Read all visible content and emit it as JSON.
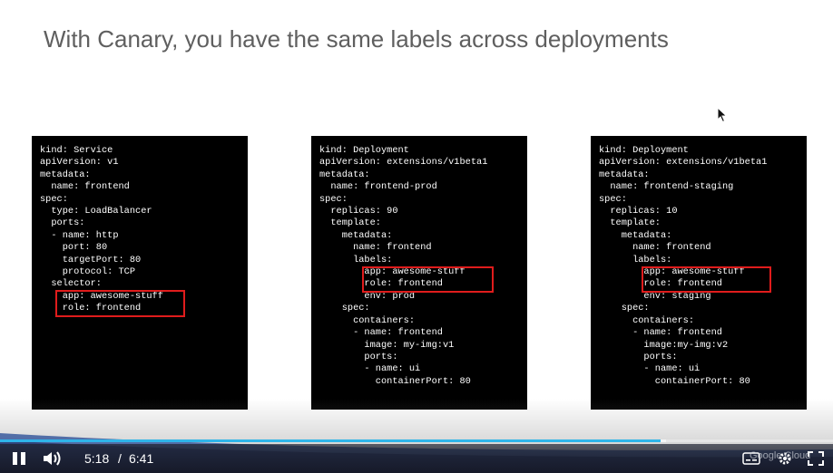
{
  "slide": {
    "title": "With Canary, you have the same labels across deployments",
    "panels": [
      {
        "code": "kind: Service\napiVersion: v1\nmetadata:\n  name: frontend\nspec:\n  type: LoadBalancer\n  ports:\n  - name: http\n    port: 80\n    targetPort: 80\n    protocol: TCP\n  selector:\n    app: awesome-stuff\n    role: frontend"
      },
      {
        "code": "kind: Deployment\napiVersion: extensions/v1beta1\nmetadata:\n  name: frontend-prod\nspec:\n  replicas: 90\n  template:\n    metadata:\n      name: frontend\n      labels:\n        app: awesome-stuff\n        role: frontend\n        env: prod\n    spec:\n      containers:\n      - name: frontend\n        image: my-img:v1\n        ports:\n        - name: ui\n          containerPort: 80"
      },
      {
        "code": "kind: Deployment\napiVersion: extensions/v1beta1\nmetadata:\n  name: frontend-staging\nspec:\n  replicas: 10\n  template:\n    metadata:\n      name: frontend\n      labels:\n        app: awesome-stuff\n        role: frontend\n        env: staging\n    spec:\n      containers:\n      - name: frontend\n        image:my-img:v2\n        ports:\n        - name: ui\n          containerPort: 80"
      }
    ],
    "highlight_color": "#e01c1c"
  },
  "player": {
    "current_time": "5:18",
    "separator": "/",
    "duration": "6:41",
    "progress": 0.793,
    "buffered": 0.8,
    "logo_text": "Google Cloud",
    "accent_color": "#2fb5e9"
  }
}
